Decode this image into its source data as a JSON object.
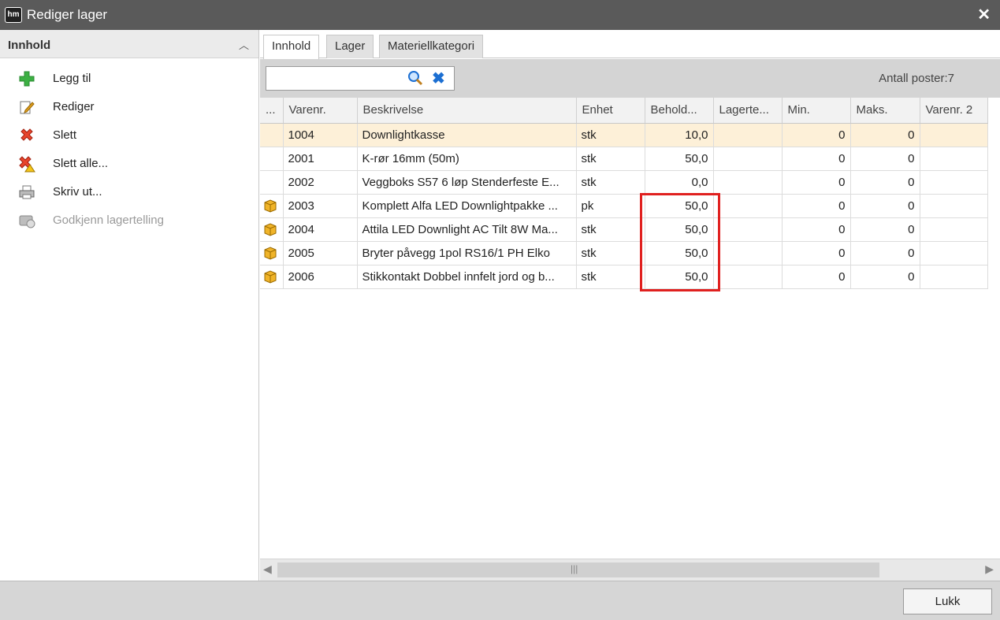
{
  "window": {
    "title": "Rediger lager",
    "app_icon_text": "hm"
  },
  "sidebar": {
    "title": "Innhold",
    "items": [
      {
        "label": "Legg til",
        "icon": "add-icon",
        "enabled": true
      },
      {
        "label": "Rediger",
        "icon": "edit-icon",
        "enabled": true
      },
      {
        "label": "Slett",
        "icon": "delete-icon",
        "enabled": true
      },
      {
        "label": "Slett alle...",
        "icon": "delete-all-icon",
        "enabled": true
      },
      {
        "label": "Skriv ut...",
        "icon": "print-icon",
        "enabled": true
      },
      {
        "label": "Godkjenn lagertelling",
        "icon": "approve-count-icon",
        "enabled": false
      }
    ]
  },
  "tabs": [
    {
      "label": "Innhold",
      "active": true
    },
    {
      "label": "Lager",
      "active": false
    },
    {
      "label": "Materiellkategori",
      "active": false
    }
  ],
  "toolbar": {
    "search_value": "",
    "count_label": "Antall poster:7"
  },
  "table": {
    "columns": [
      "...",
      "Varenr.",
      "Beskrivelse",
      "Enhet",
      "Behold...",
      "Lagerte...",
      "Min.",
      "Maks.",
      "Varenr. 2"
    ],
    "rows": [
      {
        "icon": "",
        "varenr": "1004",
        "beskrivelse": "Downlightkasse",
        "enhet": "stk",
        "beholdning": "10,0",
        "lagerteller": "",
        "min": "0",
        "maks": "0",
        "varenr2": ""
      },
      {
        "icon": "",
        "varenr": "2001",
        "beskrivelse": "K-rør 16mm (50m)",
        "enhet": "stk",
        "beholdning": "50,0",
        "lagerteller": "",
        "min": "0",
        "maks": "0",
        "varenr2": ""
      },
      {
        "icon": "",
        "varenr": "2002",
        "beskrivelse": "Veggboks S57 6 løp Stenderfeste E...",
        "enhet": "stk",
        "beholdning": "0,0",
        "lagerteller": "",
        "min": "0",
        "maks": "0",
        "varenr2": ""
      },
      {
        "icon": "package-icon",
        "varenr": "2003",
        "beskrivelse": "Komplett Alfa LED Downlightpakke ...",
        "enhet": "pk",
        "beholdning": "50,0",
        "lagerteller": "",
        "min": "0",
        "maks": "0",
        "varenr2": ""
      },
      {
        "icon": "package-icon",
        "varenr": "2004",
        "beskrivelse": "Attila LED Downlight AC Tilt 8W Ma...",
        "enhet": "stk",
        "beholdning": "50,0",
        "lagerteller": "",
        "min": "0",
        "maks": "0",
        "varenr2": ""
      },
      {
        "icon": "package-icon",
        "varenr": "2005",
        "beskrivelse": "Bryter påvegg 1pol RS16/1 PH Elko",
        "enhet": "stk",
        "beholdning": "50,0",
        "lagerteller": "",
        "min": "0",
        "maks": "0",
        "varenr2": ""
      },
      {
        "icon": "package-icon",
        "varenr": "2006",
        "beskrivelse": "Stikkontakt Dobbel innfelt jord og b...",
        "enhet": "stk",
        "beholdning": "50,0",
        "lagerteller": "",
        "min": "0",
        "maks": "0",
        "varenr2": ""
      }
    ],
    "selected_row": 0
  },
  "footer": {
    "close_label": "Lukk"
  },
  "colors": {
    "titlebar": "#5a5a5a",
    "selected_row": "#fdf0d8",
    "highlight": "#e0201f",
    "clear_icon": "#1c6fd2"
  }
}
